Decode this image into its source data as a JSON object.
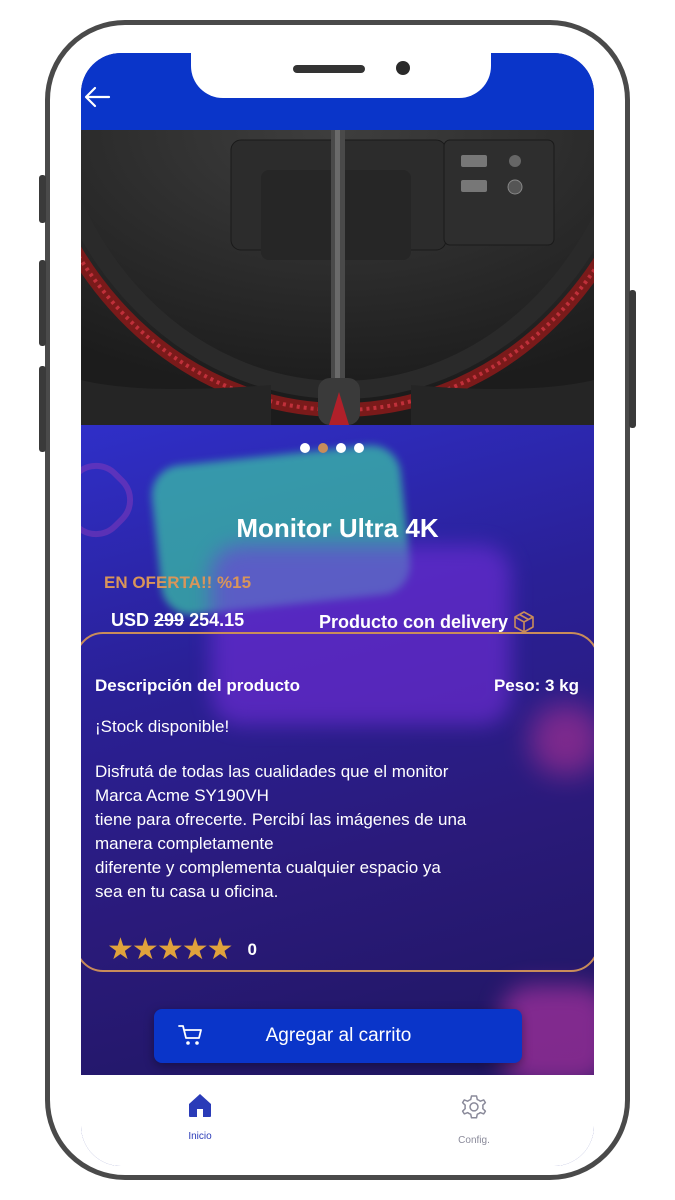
{
  "product": {
    "title": "Monitor Ultra 4K",
    "offer_label": "EN OFERTA!! %15",
    "currency": "USD",
    "old_price": "299",
    "new_price": "254.15",
    "delivery_label": "Producto con delivery",
    "description_title": "Descripción del producto",
    "weight_label": "Peso: 3 kg",
    "stock_label": "¡Stock disponible!",
    "description_lines": [
      "Disfrutá de todas las cualidades que el monitor",
      "Marca Acme SY190VH",
      "tiene para ofrecerte. Percibí las imágenes de una",
      "manera completamente",
      "diferente y complementa cualquier espacio ya",
      "sea en tu casa u oficina."
    ],
    "rating_stars": 5,
    "rating_count": "0",
    "add_to_cart_label": "Agregar al carrito"
  },
  "carousel": {
    "dot_count": 4,
    "active_index": 1
  },
  "tabbar": {
    "home_label": "Inicio",
    "config_label": "Config."
  },
  "colors": {
    "header_blue": "#0a35c9",
    "accent_orange": "#c98c5a",
    "star_gold": "#e0a23c"
  }
}
